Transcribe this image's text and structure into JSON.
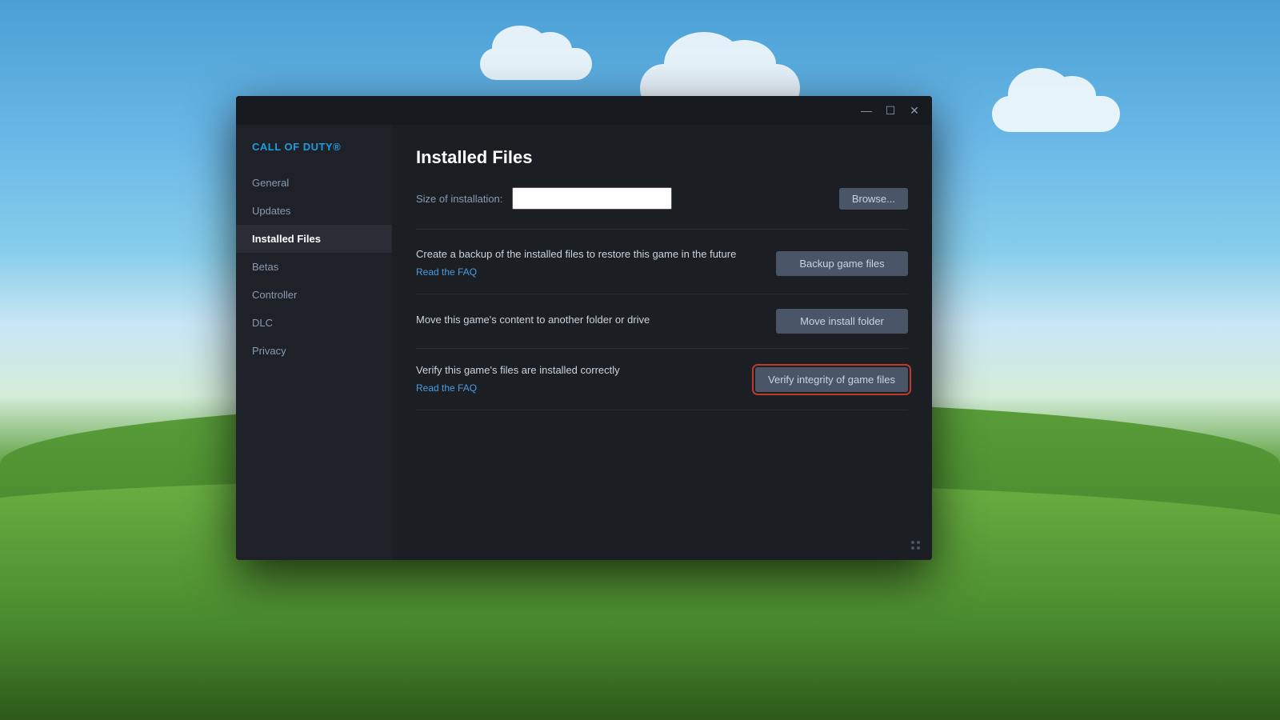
{
  "background": {
    "sky_color_top": "#4a9fd4",
    "sky_color_bottom": "#87ceeb",
    "grass_color": "#5a9e3a"
  },
  "window": {
    "titlebar": {
      "minimize_label": "—",
      "maximize_label": "☐",
      "close_label": "✕"
    }
  },
  "sidebar": {
    "game_title": "CALL OF DUTY®",
    "nav_items": [
      {
        "id": "general",
        "label": "General",
        "active": false
      },
      {
        "id": "updates",
        "label": "Updates",
        "active": false
      },
      {
        "id": "installed-files",
        "label": "Installed Files",
        "active": true
      },
      {
        "id": "betas",
        "label": "Betas",
        "active": false
      },
      {
        "id": "controller",
        "label": "Controller",
        "active": false
      },
      {
        "id": "dlc",
        "label": "DLC",
        "active": false
      },
      {
        "id": "privacy",
        "label": "Privacy",
        "active": false
      }
    ]
  },
  "main": {
    "page_title": "Installed Files",
    "install_size": {
      "label": "Size of installation:",
      "value": "",
      "placeholder": ""
    },
    "browse_button": "Browse...",
    "actions": [
      {
        "id": "backup",
        "description": "Create a backup of the installed files to restore this game in the future",
        "link_text": "Read the FAQ",
        "button_label": "Backup game files",
        "highlighted": false
      },
      {
        "id": "move-install",
        "description": "Move this game's content to another folder or drive",
        "link_text": null,
        "button_label": "Move install folder",
        "highlighted": false
      },
      {
        "id": "verify",
        "description": "Verify this game's files are installed correctly",
        "link_text": "Read the FAQ",
        "button_label": "Verify integrity of game files",
        "highlighted": true
      }
    ]
  }
}
